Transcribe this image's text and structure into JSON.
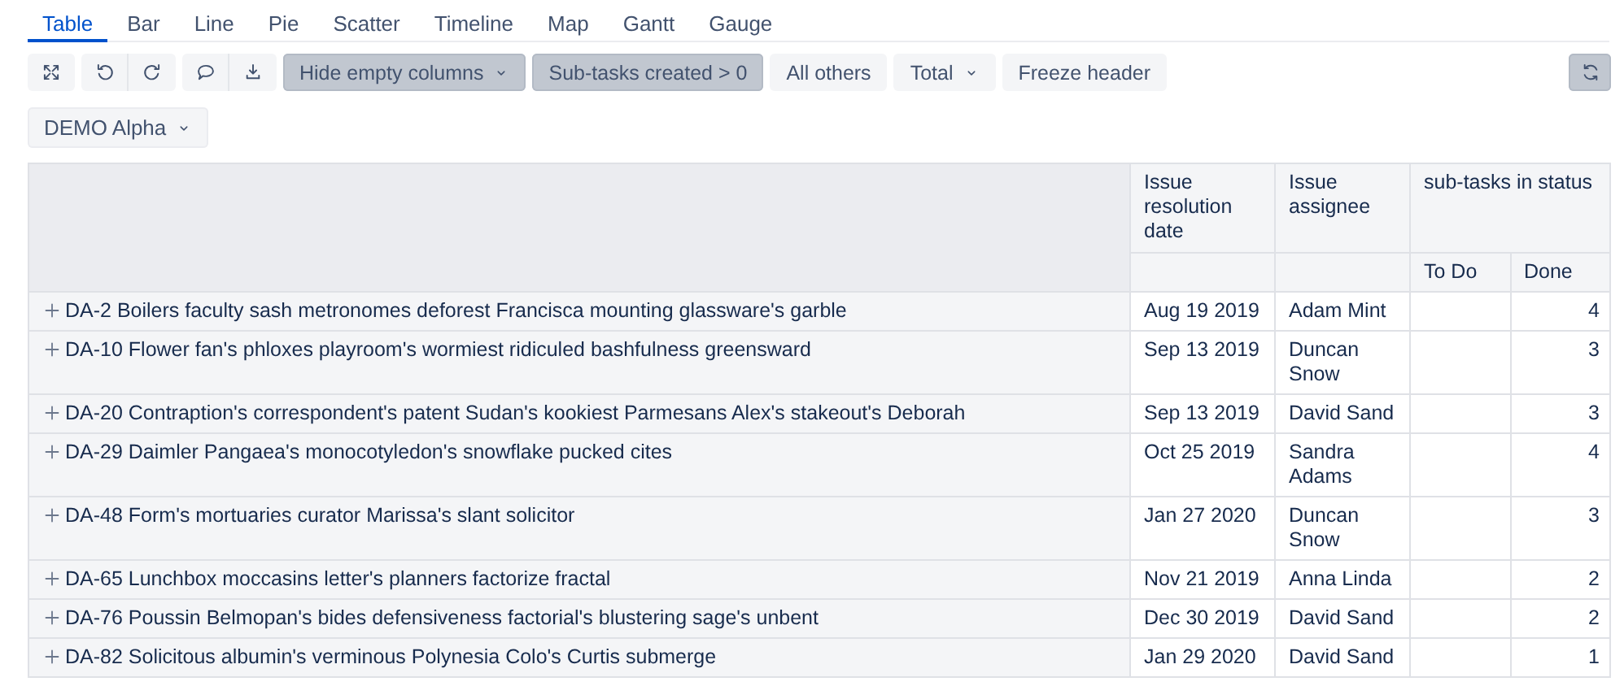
{
  "tabs": [
    {
      "label": "Table",
      "selected": true
    },
    {
      "label": "Bar",
      "selected": false
    },
    {
      "label": "Line",
      "selected": false
    },
    {
      "label": "Pie",
      "selected": false
    },
    {
      "label": "Scatter",
      "selected": false
    },
    {
      "label": "Timeline",
      "selected": false
    },
    {
      "label": "Map",
      "selected": false
    },
    {
      "label": "Gantt",
      "selected": false
    },
    {
      "label": "Gauge",
      "selected": false
    }
  ],
  "toolbar": [
    {
      "kind": "button",
      "label": "Hide empty columns",
      "pressed": true,
      "dropdown": true
    },
    {
      "kind": "button",
      "label": "Sub-tasks created > 0",
      "pressed": true,
      "dropdown": false
    },
    {
      "kind": "button",
      "label": "All others",
      "pressed": false,
      "dropdown": false
    },
    {
      "kind": "button",
      "label": "Total",
      "pressed": false,
      "dropdown": true
    },
    {
      "kind": "button",
      "label": "Freeze header",
      "pressed": false,
      "dropdown": false
    }
  ],
  "refresh": {
    "pressed": true
  },
  "project_select": {
    "label": "DEMO Alpha"
  },
  "table": {
    "columns": [
      {
        "label": "Issue resolution date"
      },
      {
        "label": "Issue assignee"
      },
      {
        "label": "sub-tasks in status",
        "children": [
          "To Do",
          "Done"
        ]
      }
    ],
    "rows": [
      {
        "issue": "DA-2 Boilers faculty sash metronomes deforest Francisca mounting glassware's garble",
        "date": "Aug 19 2019",
        "assignee": "Adam Mint",
        "done": "4"
      },
      {
        "issue": "DA-10 Flower fan's phloxes playroom's wormiest ridiculed bashfulness greensward",
        "date": "Sep 13 2019",
        "assignee": "Duncan Snow",
        "done": "3"
      },
      {
        "issue": "DA-20 Contraption's correspondent's patent Sudan's kookiest Parmesans Alex's stakeout's Deborah",
        "date": "Sep 13 2019",
        "assignee": "David Sand",
        "done": "3"
      },
      {
        "issue": "DA-29 Daimler Pangaea's monocotyledon's snowflake pucked cites",
        "date": "Oct 25 2019",
        "assignee": "Sandra Adams",
        "done": "4"
      },
      {
        "issue": "DA-48 Form's mortuaries curator Marissa's slant solicitor",
        "date": "Jan 27 2020",
        "assignee": "Duncan Snow",
        "done": "3"
      },
      {
        "issue": "DA-65 Lunchbox moccasins letter's planners factorize fractal",
        "date": "Nov 21 2019",
        "assignee": "Anna Linda",
        "done": "2"
      },
      {
        "issue": "DA-76 Poussin Belmopan's bides defensiveness factorial's blustering sage's unbent",
        "date": "Dec 30 2019",
        "assignee": "David Sand",
        "done": "2"
      },
      {
        "issue": "DA-82 Solicitous albumin's verminous Polynesia Colo's Curtis submerge",
        "date": "Jan 29 2020",
        "assignee": "David Sand",
        "done": "1"
      }
    ]
  }
}
